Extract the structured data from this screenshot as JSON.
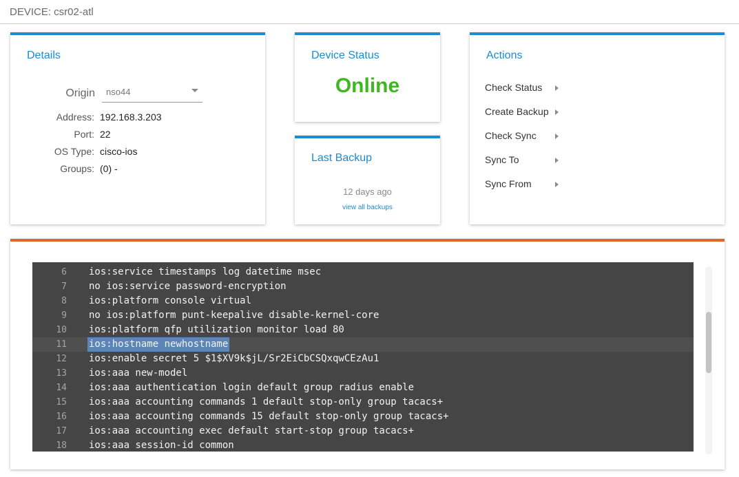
{
  "header": {
    "device_title": "DEVICE: csr02-atl"
  },
  "details": {
    "title": "Details",
    "origin_label": "Origin",
    "origin_value": "nso44",
    "fields": [
      {
        "label": "Address:",
        "value": "192.168.3.203"
      },
      {
        "label": "Port:",
        "value": "22"
      },
      {
        "label": "OS Type:",
        "value": "cisco-ios"
      },
      {
        "label": "Groups:",
        "value": "(0) -"
      }
    ]
  },
  "device_status": {
    "title": "Device Status",
    "value": "Online",
    "value_color": "#3db820"
  },
  "last_backup": {
    "title": "Last Backup",
    "age": "12 days ago",
    "link_label": "view all backups"
  },
  "actions": {
    "title": "Actions",
    "items": [
      {
        "label": "Check Status",
        "icon": "chevron-right-icon"
      },
      {
        "label": "Create Backup",
        "icon": "chevron-right-icon"
      },
      {
        "label": "Check Sync",
        "icon": "chevron-right-icon"
      },
      {
        "label": "Sync To",
        "icon": "chevron-right-icon"
      },
      {
        "label": "Sync From",
        "icon": "chevron-right-icon"
      }
    ]
  },
  "colors": {
    "accent_blue": "#1b8bd2",
    "accent_orange": "#e0662a",
    "editor_bg": "#454545",
    "selection": "#5b87b8"
  },
  "editor": {
    "lines": [
      {
        "num": "6",
        "text": "ios:service timestamps log datetime msec"
      },
      {
        "num": "7",
        "text": "no ios:service password-encryption"
      },
      {
        "num": "8",
        "text": "ios:platform console virtual"
      },
      {
        "num": "9",
        "text": "no ios:platform punt-keepalive disable-kernel-core"
      },
      {
        "num": "10",
        "text": "ios:platform qfp utilization monitor load 80"
      },
      {
        "num": "11",
        "text": "ios:hostname newhostname"
      },
      {
        "num": "12",
        "text": "ios:enable secret 5 $1$XV9k$jL/Sr2EiCbCSQxqwCEzAu1"
      },
      {
        "num": "13",
        "text": "ios:aaa new-model"
      },
      {
        "num": "14",
        "text": "ios:aaa authentication login default group radius enable"
      },
      {
        "num": "15",
        "text": "ios:aaa accounting commands 1 default stop-only group tacacs+"
      },
      {
        "num": "16",
        "text": "ios:aaa accounting commands 15 default stop-only group tacacs+"
      },
      {
        "num": "17",
        "text": "ios:aaa accounting exec default start-stop group tacacs+"
      },
      {
        "num": "18",
        "text": "ios:aaa session-id common"
      }
    ],
    "active_line": "11"
  }
}
